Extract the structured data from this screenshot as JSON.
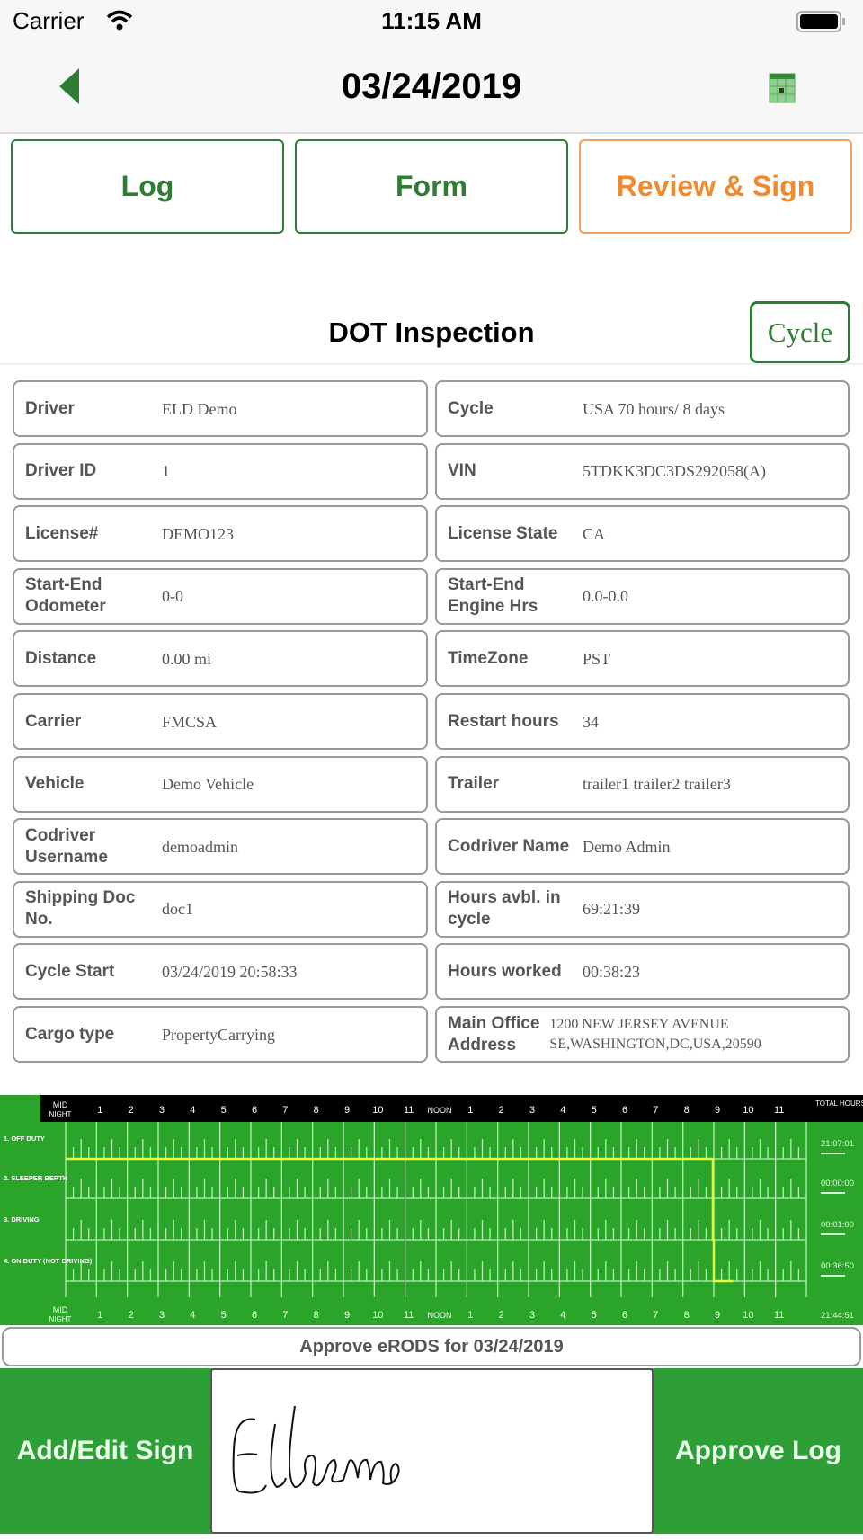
{
  "status_bar": {
    "carrier": "Carrier",
    "time": "11:15 AM",
    "wifi_icon": "wifi-icon",
    "battery_icon": "battery-icon"
  },
  "nav": {
    "title": "03/24/2019",
    "back_icon": "back-triangle-icon",
    "calendar_icon": "calendar-icon"
  },
  "tabs": [
    {
      "label": "Log",
      "active": false
    },
    {
      "label": "Form",
      "active": false
    },
    {
      "label": "Review & Sign",
      "active": true
    }
  ],
  "section": {
    "title": "DOT Inspection",
    "cycle_button": "Cycle"
  },
  "fields": [
    [
      {
        "label": "Driver",
        "value": "ELD Demo"
      },
      {
        "label": "Cycle",
        "value": "USA 70 hours/ 8 days"
      }
    ],
    [
      {
        "label": "Driver ID",
        "value": "1"
      },
      {
        "label": "VIN",
        "value": "5TDKK3DC3DS292058(A)"
      }
    ],
    [
      {
        "label": "License#",
        "value": "DEMO123"
      },
      {
        "label": "License State",
        "value": "CA"
      }
    ],
    [
      {
        "label": "Start-End Odometer",
        "value": "0-0"
      },
      {
        "label": "Start-End Engine Hrs",
        "value": "0.0-0.0"
      }
    ],
    [
      {
        "label": "Distance",
        "value": "0.00 mi"
      },
      {
        "label": "TimeZone",
        "value": "PST"
      }
    ],
    [
      {
        "label": "Carrier",
        "value": "FMCSA"
      },
      {
        "label": "Restart hours",
        "value": "34"
      }
    ],
    [
      {
        "label": "Vehicle",
        "value": "Demo Vehicle"
      },
      {
        "label": "Trailer",
        "value": "trailer1 trailer2 trailer3"
      }
    ],
    [
      {
        "label": "Codriver Username",
        "value": "demoadmin"
      },
      {
        "label": "Codriver Name",
        "value": "Demo Admin"
      }
    ],
    [
      {
        "label": "Shipping Doc No.",
        "value": "doc1"
      },
      {
        "label": "Hours avbl. in cycle",
        "value": "69:21:39"
      }
    ],
    [
      {
        "label": "Cycle Start",
        "value": "03/24/2019 20:58:33"
      },
      {
        "label": "Hours worked",
        "value": "00:38:23"
      }
    ],
    [
      {
        "label": "Cargo type",
        "value": "PropertyCarrying"
      },
      {
        "label": "Main Office Address",
        "value": "1200 NEW JERSEY AVENUE SE,WASHINGTON,DC,USA,20590"
      }
    ]
  ],
  "chart_data": {
    "type": "line",
    "hour_labels": [
      "MID NIGHT",
      "1",
      "2",
      "3",
      "4",
      "5",
      "6",
      "7",
      "8",
      "9",
      "10",
      "11",
      "NOON",
      "1",
      "2",
      "3",
      "4",
      "5",
      "6",
      "7",
      "8",
      "9",
      "10",
      "11"
    ],
    "total_header": "TOTAL HOURS",
    "rows": [
      {
        "label": "1. OFF DUTY",
        "total": "21:07:01"
      },
      {
        "label": "2. SLEEPER BERTH",
        "total": "00:00:00"
      },
      {
        "label": "3. DRIVING",
        "total": "00:01:00"
      },
      {
        "label": "4. ON DUTY (NOT DRIVING)",
        "total": "00:36:50"
      }
    ],
    "grand_total": "21:44:51",
    "xlim": [
      0,
      24
    ],
    "segments": [
      {
        "status": 1,
        "start": 0,
        "end": 20.97
      },
      {
        "status": 3,
        "start": 20.97,
        "end": 21.0
      },
      {
        "status": 4,
        "start": 21.0,
        "end": 21.62
      }
    ],
    "line_color": "#e6ff3a",
    "background": "#2aa52a"
  },
  "approve_bar": "Approve eRODS for 03/24/2019",
  "bottom": {
    "add_edit": "Add/Edit Sign",
    "approve_log": "Approve Log",
    "signature_text": "Eldemo"
  }
}
